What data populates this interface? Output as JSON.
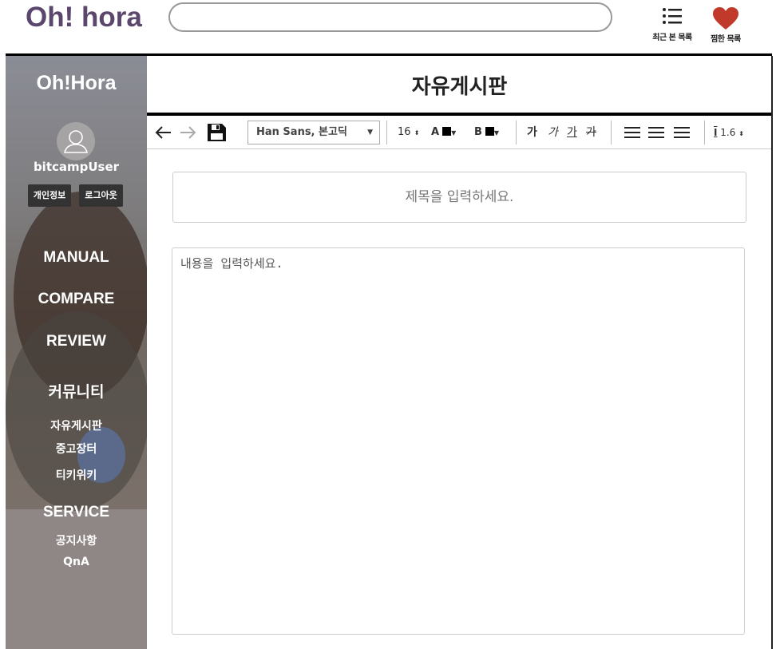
{
  "header": {
    "logo": "Oh! hora",
    "recent_label": "최근 본 목록",
    "liked_label": "찜한 목록"
  },
  "sidebar": {
    "brand": "Oh!Hora",
    "username": "bitcampUser",
    "profile_button": "개인정보",
    "logout_button": "로그아웃",
    "menu": [
      "MANUAL",
      "COMPARE",
      "REVIEW",
      "커뮤니티"
    ],
    "community_items": [
      "자유게시판",
      "중고장터",
      "티키위키"
    ],
    "service_title": "SERVICE",
    "service_items": [
      "공지사항",
      "QnA"
    ]
  },
  "main": {
    "title": "자유게시판",
    "toolbar": {
      "font": "Han Sans, 본고딕",
      "font_size": "16",
      "text_color_label": "A",
      "bg_color_label": "B",
      "style_bold": "가",
      "style_italic": "가",
      "style_underline": "가",
      "style_strike": "가",
      "line_height": "1.6"
    },
    "title_placeholder": "제목을 입력하세요.",
    "content_placeholder": "내용을 입력하세요."
  },
  "colors": {
    "brand": "#5b466e",
    "heart": "#c0392b",
    "sidebar_bottom": "#8f8786"
  }
}
